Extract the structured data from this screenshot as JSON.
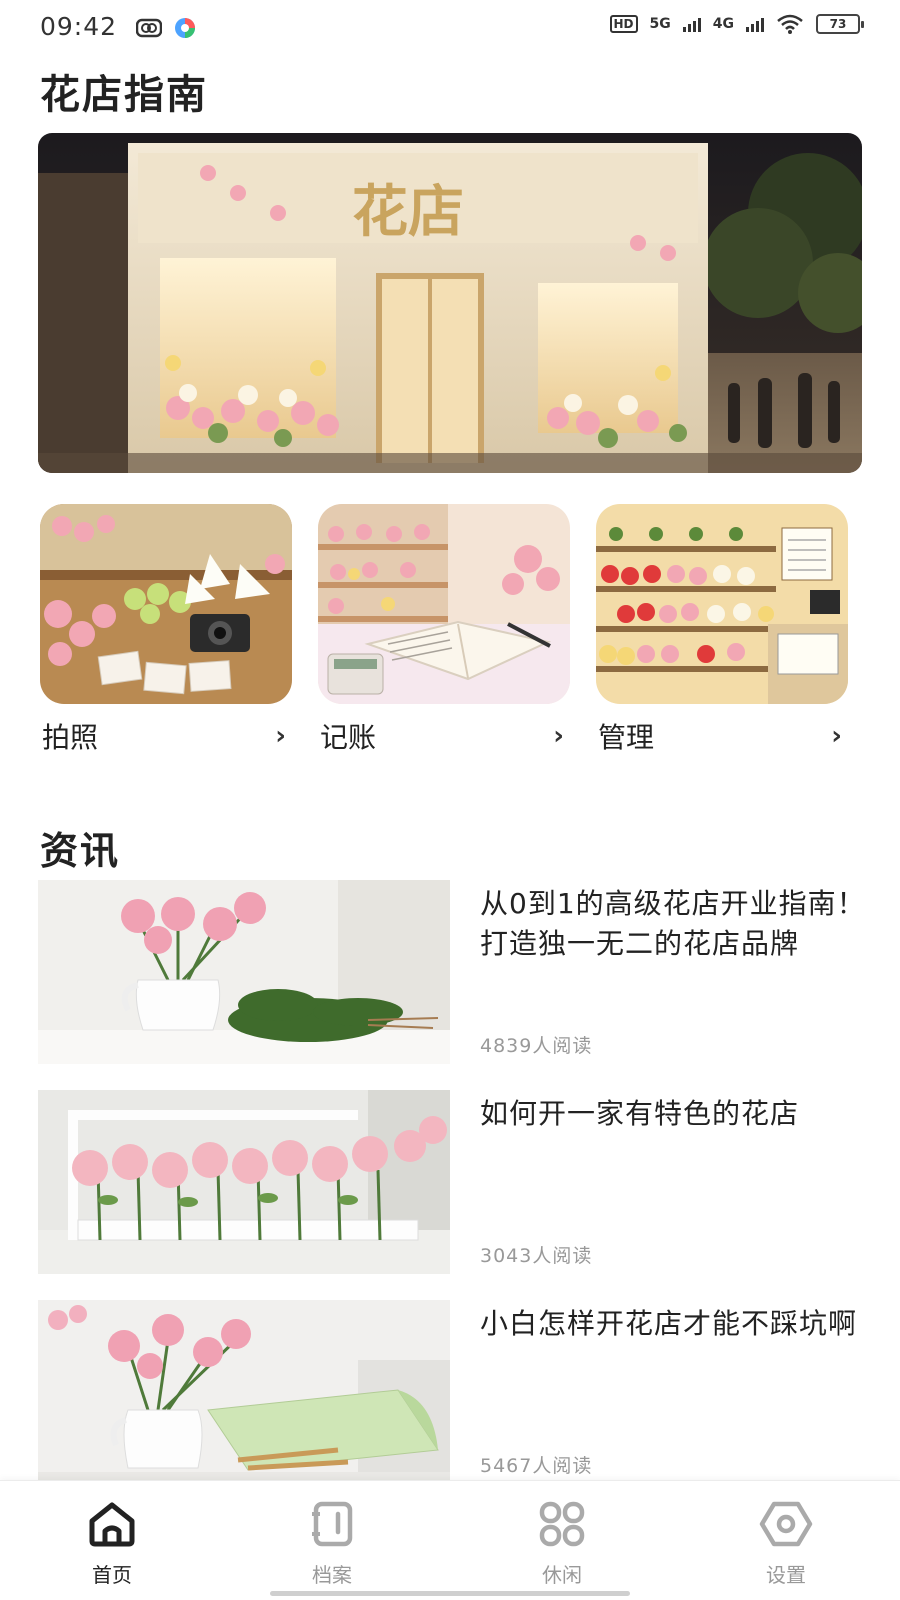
{
  "status_bar": {
    "time": "09:42",
    "hd": "HD",
    "net1": "5G",
    "net2": "4G",
    "battery": "73"
  },
  "header": {
    "title": "花店指南"
  },
  "hero": {
    "sign_text": "花店"
  },
  "features": [
    {
      "label": "拍照",
      "icon": "chevron-right-icon"
    },
    {
      "label": "记账",
      "icon": "chevron-right-icon"
    },
    {
      "label": "管理",
      "icon": "chevron-right-icon"
    }
  ],
  "news_section": {
    "title": "资讯"
  },
  "news": [
    {
      "title": "从0到1的高级花店开业指南！打造独一无二的花店品牌",
      "reads": "4839人阅读"
    },
    {
      "title": "如何开一家有特色的花店",
      "reads": "3043人阅读"
    },
    {
      "title": "小白怎样开花店才能不踩坑啊",
      "reads": "5467人阅读"
    }
  ],
  "bottom_nav": [
    {
      "label": "首页",
      "icon": "home-icon",
      "active": true
    },
    {
      "label": "档案",
      "icon": "notebook-icon",
      "active": false
    },
    {
      "label": "休闲",
      "icon": "grid-icon",
      "active": false
    },
    {
      "label": "设置",
      "icon": "settings-icon",
      "active": false
    }
  ],
  "colors": {
    "accent": "#222222",
    "inactive": "#999999",
    "rose": "#f2a7b4"
  }
}
